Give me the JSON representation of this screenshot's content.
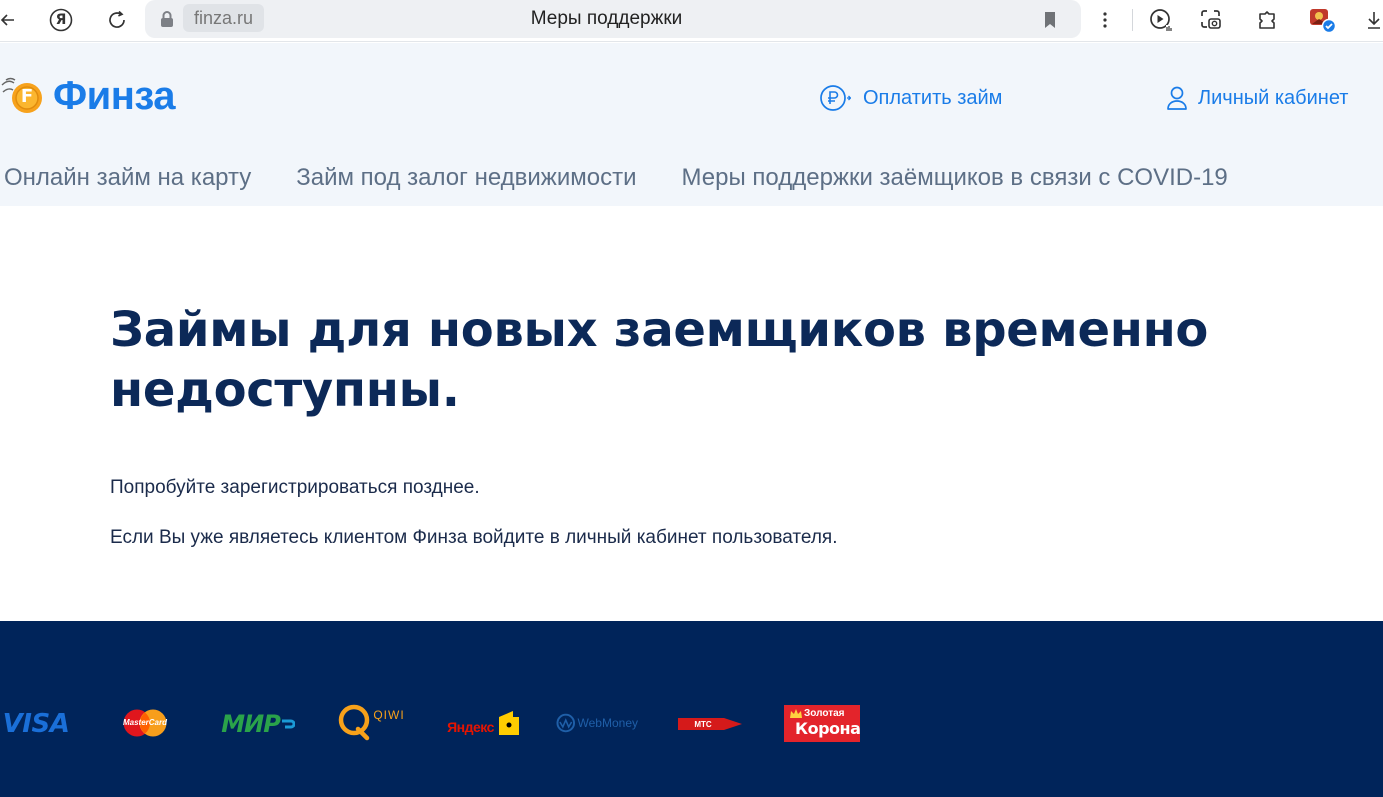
{
  "browser": {
    "url": "finza.ru",
    "tab_title": "Меры поддержки",
    "yandex_glyph": "Я",
    "icons": [
      "back-arrow-icon",
      "yandex-icon",
      "reload-icon",
      "lock-icon",
      "bookmark-icon",
      "more-icon",
      "play-icon",
      "screenshot-icon",
      "extensions-icon",
      "profile-avatar-icon",
      "download-icon"
    ]
  },
  "header": {
    "logo_text": "Финза",
    "logo_coin_letter": "F",
    "pay_loan": "Оплатить займ",
    "account": "Личный кабинет",
    "nav": [
      "Онлайн займ на карту",
      "Займ под залог недвижимости",
      "Меры поддержки заёмщиков в связи с COVID-19"
    ]
  },
  "main": {
    "title": "Займы для новых заемщиков временно недоступны.",
    "p1": "Попробуйте зарегистрироваться позднее.",
    "p2": "Если Вы уже являетесь клиентом Финза войдите в личный кабинет пользователя."
  },
  "footer": {
    "payments": {
      "visa": "VISA",
      "mastercard": "MasterCard",
      "mir": "МИР",
      "qiwi": "QIWI",
      "yandex": "Яндекс",
      "webmoney": "WebMoney",
      "mts": "МТС",
      "zolotaya_top": "Золотая",
      "zolotaya_bottom": "Корона"
    }
  },
  "colors": {
    "brand_blue": "#1a7ce8",
    "header_bg": "#f2f6fb",
    "title_navy": "#0c2958",
    "footer_bg": "#00245a"
  }
}
